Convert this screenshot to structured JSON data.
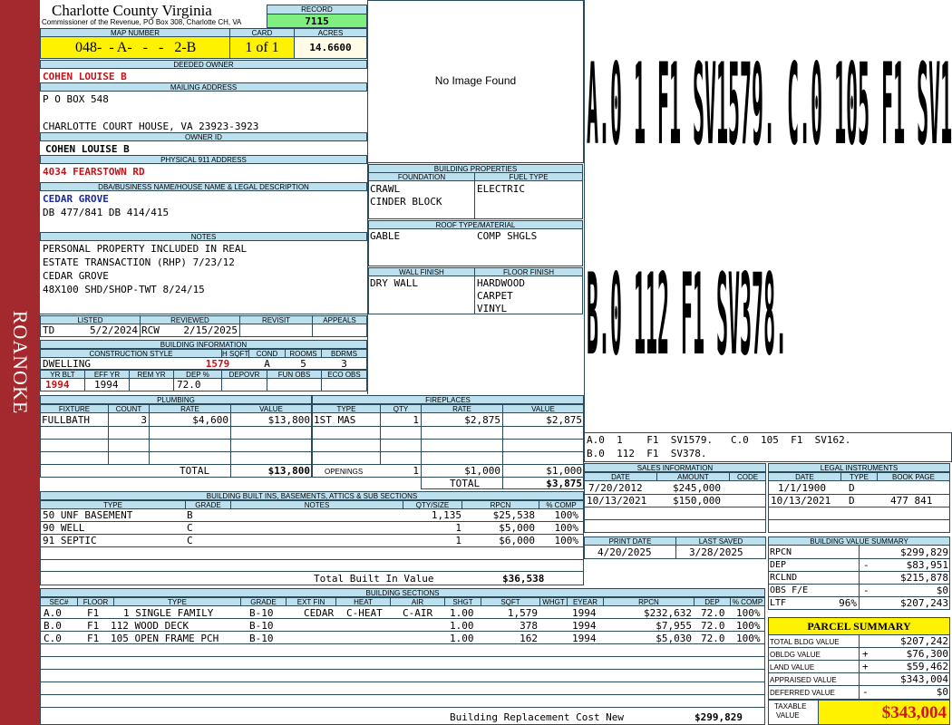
{
  "sidebar": {
    "label": "ROANOKE"
  },
  "header": {
    "county": "Charlotte County Virginia",
    "commissioner": "Commissioner of the Revenue, PO Box 308, Charlotte CH, VA",
    "record_label": "RECORD",
    "record": "7115",
    "map_number_label": "MAP NUMBER",
    "map_number": "048-  - A-   -   -   2-B",
    "card_label": "CARD",
    "card": "1 of 1",
    "acres_label": "ACRES",
    "acres": "14.6600"
  },
  "owner": {
    "deeded_owner_label": "DEEDED OWNER",
    "deeded_owner": "COHEN LOUISE B",
    "mailing_label": "MAILING ADDRESS",
    "mailing_line1": "P O BOX 548",
    "mailing_line2": "CHARLOTTE COURT HOUSE, VA 23923-3923",
    "owner_id_label": "OWNER ID",
    "owner_id": "COHEN LOUISE B",
    "physical_label": "PHYSICAL 911 ADDRESS",
    "physical": "4034 FEARSTOWN RD",
    "dba_label": "DBA/BUSINESS NAME/HOUSE NAME & LEGAL DESCRIPTION",
    "dba_name": "CEDAR GROVE",
    "legal": "DB 477/841 DB 414/415"
  },
  "notes": {
    "label": "NOTES",
    "lines": [
      "PERSONAL PROPERTY INCLUDED IN REAL",
      "ESTATE TRANSACTION (RHP) 7/23/12",
      "CEDAR GROVE",
      "48X100 SHD/SHOP-TWT 8/24/15"
    ]
  },
  "review": {
    "listed_label": "LISTED",
    "reviewed_label": "REVIEWED",
    "revisit_label": "REVISIT",
    "appeals_label": "APPEALS",
    "listed_by": "TD",
    "listed_date": "5/2/2024",
    "reviewed_by": "RCW",
    "reviewed_date": "2/15/2025"
  },
  "building_info": {
    "label": "BUILDING INFORMATION",
    "h_style": "CONSTRUCTION STYLE",
    "h_sqft": "H SQFT",
    "h_cond": "COND",
    "h_rooms": "ROOMS",
    "h_bdrms": "BDRMS",
    "style": "DWELLING",
    "sqft": "1579",
    "cond": "A",
    "rooms": "5",
    "bdrms": "3",
    "h_yrblt": "YR BLT",
    "h_effyr": "EFF YR",
    "h_remyr": "REM YR",
    "h_dep": "DEP %",
    "h_depovr": "DEPOVR",
    "h_funobs": "FUN OBS",
    "h_ecoobs": "ECO OBS",
    "yrblt": "1994",
    "effyr": "1994",
    "dep": "72.0"
  },
  "image": {
    "text": "No Image Found"
  },
  "building_props": {
    "label": "BUILDING PROPERTIES",
    "foundation_label": "FOUNDATION",
    "fueltype_label": "FUEL TYPE",
    "foundation1": "CRAWL",
    "foundation2": "CINDER BLOCK",
    "fuel": "ELECTRIC",
    "roof_label": "ROOF TYPE/MATERIAL",
    "roof_type": "GABLE",
    "roof_material": "COMP SHGLS",
    "wall_label": "WALL FINISH",
    "floor_label": "FLOOR FINISH",
    "wall": "DRY WALL",
    "floor1": "HARDWOOD",
    "floor2": "CARPET",
    "floor3": "VINYL"
  },
  "sketch": {
    "line1": "A.0 1 F1 SV1579. C.0 105 F1 SV162.",
    "line2": "B.0 112 F1 SV378.",
    "legend1": "A.0  1    F1  SV1579.   C.0  105  F1  SV162.",
    "legend2": "B.0  112  F1  SV378."
  },
  "plumbing": {
    "label": "PLUMBING",
    "h_fixture": "FIXTURE",
    "h_count": "COUNT",
    "h_rate": "RATE",
    "h_value": "VALUE",
    "fixture": "FULLBATH",
    "count": "3",
    "rate": "$4,600",
    "value": "$13,800",
    "total_label": "TOTAL",
    "total": "$13,800"
  },
  "fireplaces": {
    "label": "FIREPLACES",
    "h_type": "TYPE",
    "h_qty": "QTY",
    "h_rate": "RATE",
    "h_value": "VALUE",
    "type": "1ST MAS",
    "qty": "1",
    "rate": "$2,875",
    "value": "$2,875",
    "openings_label": "OPENINGS",
    "openings_qty": "1",
    "openings_rate": "$1,000",
    "openings_value": "$1,000",
    "total_label": "TOTAL",
    "total": "$3,875"
  },
  "sales": {
    "label": "SALES INFORMATION",
    "h_date": "DATE",
    "h_amount": "AMOUNT",
    "h_code": "CODE",
    "rows": [
      {
        "date": "7/20/2012",
        "amount": "$245,000"
      },
      {
        "date": "10/13/2021",
        "amount": "$150,000"
      }
    ]
  },
  "legal_instruments": {
    "label": "LEGAL INSTRUMENTS",
    "h_date": "DATE",
    "h_type": "TYPE",
    "h_bookpage": "BOOK PAGE",
    "rows": [
      {
        "date": "1/1/1900",
        "type": "D",
        "bookpage": ""
      },
      {
        "date": "10/13/2021",
        "type": "D",
        "bookpage": "477 841"
      }
    ]
  },
  "dates": {
    "print_label": "PRINT DATE",
    "saved_label": "LAST SAVED",
    "print": "4/20/2025",
    "saved": "3/28/2025"
  },
  "builtins": {
    "label": "BUILDING BUILT INS, BASEMENTS, ATTICS & SUB SECTIONS",
    "h_type": "TYPE",
    "h_grade": "GRADE",
    "h_notes": "NOTES",
    "h_qty": "QTY/SIZE",
    "h_rpcn": "RPCN",
    "h_comp": "% COMP",
    "rows": [
      {
        "type": "50 UNF BASEMENT",
        "grade": "B",
        "qty": "1,135",
        "rpcn": "$25,538",
        "comp": "100%"
      },
      {
        "type": "90 WELL",
        "grade": "C",
        "qty": "1",
        "rpcn": "$5,000",
        "comp": "100%"
      },
      {
        "type": "91 SEPTIC",
        "grade": "C",
        "qty": "1",
        "rpcn": "$6,000",
        "comp": "100%"
      }
    ],
    "total_label": "Total Built In Value",
    "total": "$36,538"
  },
  "value_summary": {
    "label": "BUILDING VALUE SUMMARY",
    "rows": [
      {
        "label": "RPCN",
        "sign": "",
        "value": "$299,829"
      },
      {
        "label": "DEP",
        "sign": "-",
        "value": "$83,951"
      },
      {
        "label": "RCLND",
        "sign": "",
        "value": "$215,878"
      },
      {
        "label": "OBS F/E",
        "sign": "-",
        "value": "$0"
      },
      {
        "label": "LTF",
        "sign": "96%",
        "value": "$207,243"
      }
    ]
  },
  "sections": {
    "label": "BUILDING SECTIONS",
    "h_sec": "SEC#",
    "h_floor": "FLOOR",
    "h_type": "TYPE",
    "h_grade": "GRADE",
    "h_extfin": "EXT FIN",
    "h_heat": "HEAT",
    "h_air": "AIR",
    "h_shgt": "SHGT",
    "h_sqft": "SQFT",
    "h_whgt": "WHGT",
    "h_eyear": "EYEAR",
    "h_rpcn": "RPCN",
    "h_dep": "DEP",
    "h_comp": "% COMP",
    "rows": [
      {
        "sec": "A.0",
        "floor": "F1",
        "type": "1 SINGLE FAMILY",
        "grade": "B-10",
        "extfin": "CEDAR",
        "heat": "C-HEAT",
        "air": "C-AIR",
        "shgt": "1.00",
        "sqft": "1,579",
        "eyear": "1994",
        "rpcn": "$232,632",
        "dep": "72.0",
        "comp": "100%"
      },
      {
        "sec": "B.0",
        "floor": "F1",
        "type": "112 WOOD DECK",
        "grade": "B-10",
        "extfin": "",
        "heat": "",
        "air": "",
        "shgt": "1.00",
        "sqft": "378",
        "eyear": "1994",
        "rpcn": "$7,955",
        "dep": "72.0",
        "comp": "100%"
      },
      {
        "sec": "C.0",
        "floor": "F1",
        "type": "105 OPEN FRAME PCH",
        "grade": "B-10",
        "extfin": "",
        "heat": "",
        "air": "",
        "shgt": "1.00",
        "sqft": "162",
        "eyear": "1994",
        "rpcn": "$5,030",
        "dep": "72.0",
        "comp": "100%"
      }
    ],
    "total_label": "Building Replacement Cost New",
    "total": "$299,829"
  },
  "parcel_summary": {
    "label": "PARCEL SUMMARY",
    "rows": [
      {
        "label": "TOTAL BLDG VALUE",
        "sign": "",
        "value": "$207,242"
      },
      {
        "label": "OBLDG VALUE",
        "sign": "+",
        "value": "$76,300"
      },
      {
        "label": "LAND VALUE",
        "sign": "+",
        "value": "$59,462"
      },
      {
        "label": "APPRAISED VALUE",
        "sign": "",
        "value": "$343,004"
      },
      {
        "label": "DEFERRED VALUE",
        "sign": "-",
        "value": "$0"
      }
    ],
    "taxable_label1": "TAXABLE",
    "taxable_label2": "VALUE",
    "taxable": "$343,004"
  }
}
